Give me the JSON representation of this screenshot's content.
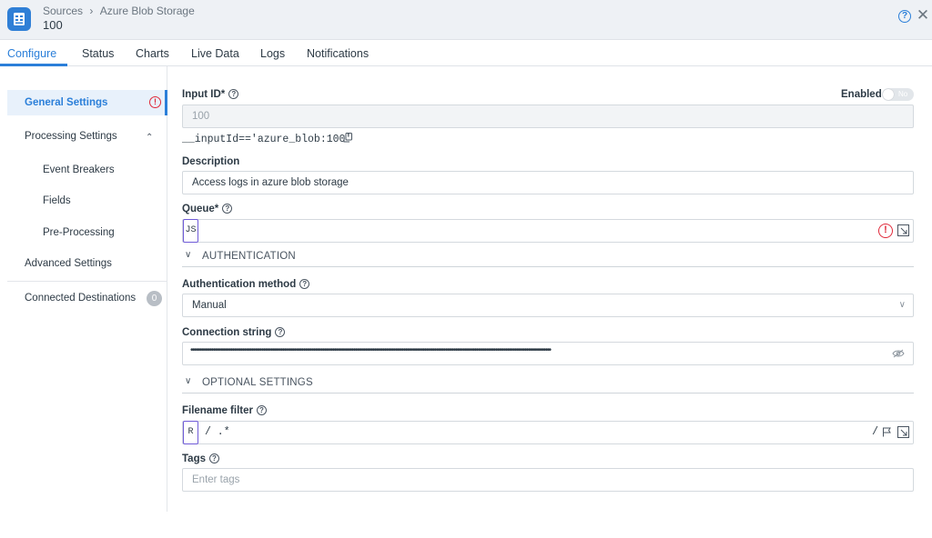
{
  "header": {
    "breadcrumb_root": "Sources",
    "breadcrumb_separator": "›",
    "breadcrumb_current": "Azure Blob Storage",
    "title": "100",
    "help_icon": "?",
    "close_icon": "✕"
  },
  "tabs": [
    {
      "label": "Configure",
      "active": true
    },
    {
      "label": "Status"
    },
    {
      "label": "Charts"
    },
    {
      "label": "Live Data"
    },
    {
      "label": "Logs"
    },
    {
      "label": "Notifications"
    }
  ],
  "sidebar": {
    "general_settings": "General Settings",
    "general_warning": "!",
    "processing_settings": "Processing Settings",
    "event_breakers": "Event Breakers",
    "fields": "Fields",
    "pre_processing": "Pre-Processing",
    "advanced_settings": "Advanced Settings",
    "connected_destinations": "Connected Destinations",
    "connected_count": "0"
  },
  "form": {
    "input_id_label": "Input ID*",
    "input_id_value": "100",
    "enabled_label": "Enabled",
    "enabled_toggle_text": "No",
    "input_expression": "__inputId=='azure_blob:100'",
    "description_label": "Description",
    "description_value": "Access logs in azure blob storage",
    "queue_label": "Queue*",
    "queue_lang": "JS",
    "queue_error": "!",
    "authentication_section": "AUTHENTICATION",
    "auth_method_label": "Authentication method",
    "auth_method_value": "Manual",
    "connection_string_label": "Connection string",
    "connection_string_dots": "••••••••••••••••••••••••••••••••••••••••••••••••••••••••••••••••••••••••••••••••••••••••••••••••••••••••••••••••••••••••••••••••••••••••••••••••••••••••••••••••••••••••••••••••••••••••••••••••••••••••••••••••",
    "optional_section": "OPTIONAL SETTINGS",
    "filename_filter_label": "Filename filter",
    "filename_filter_lang": "R",
    "filename_filter_value": "/ .*",
    "filename_filter_end": "/",
    "tags_label": "Tags",
    "tags_placeholder": "Enter tags"
  },
  "colors": {
    "accent": "#2b7fd9",
    "error": "#e0293a",
    "lang_badge_border": "#6f5bd8"
  }
}
